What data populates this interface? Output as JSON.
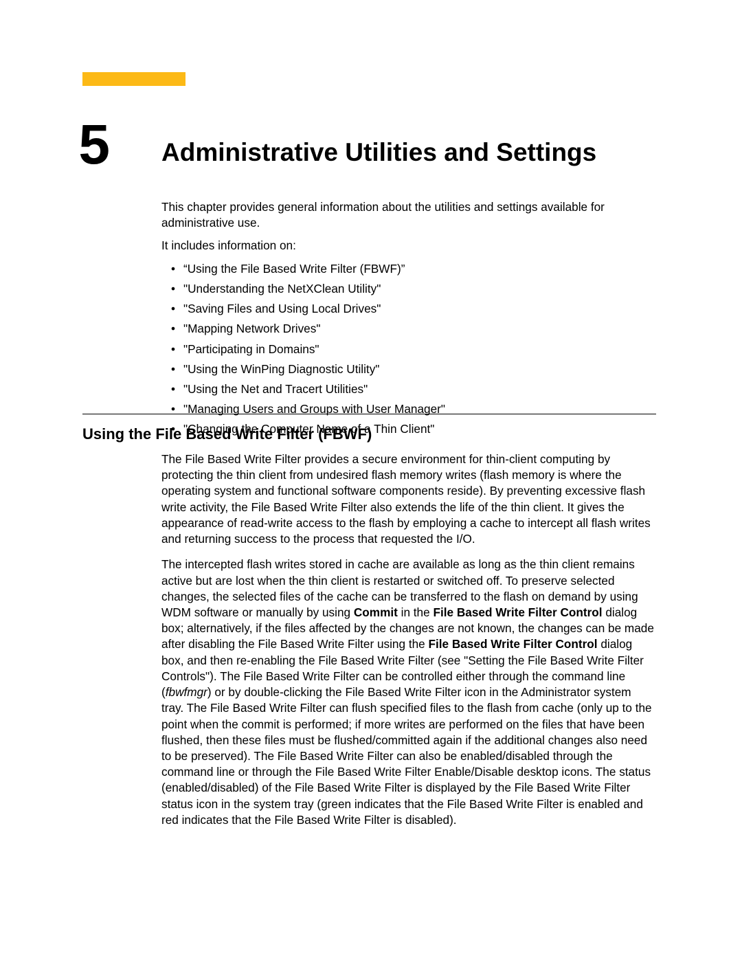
{
  "chapter": {
    "number": "5",
    "title": "Administrative Utilities and Settings"
  },
  "intro": {
    "p1": "This chapter provides general information about the utilities and settings available for administrative use.",
    "p2": "It includes information on:",
    "items": [
      "“Using the File Based Write Filter (FBWF)”",
      "\"Understanding the NetXClean Utility\"",
      "\"Saving Files and Using Local Drives\"",
      "\"Mapping Network Drives\"",
      "\"Participating in Domains\"",
      "\"Using the WinPing Diagnostic Utility\"",
      "\"Using the Net and Tracert Utilities\"",
      "\"Managing Users and Groups with User Manager\"",
      "\"Changing the Computer Name of a Thin Client\""
    ]
  },
  "section": {
    "heading": "Using the File Based Write Filter (FBWF)",
    "p1": "The File Based Write Filter provides a secure environment for thin-client computing by protecting the thin client from undesired flash memory writes (flash memory is where the operating system and functional software components reside). By preventing excessive flash write activity, the File Based Write Filter also extends the life of the thin client. It gives the appearance of read-write access to the flash by employing a cache to intercept all flash writes and returning success to the process that requested the I/O.",
    "p2a": "The intercepted flash writes stored in cache are available as long as the thin client remains active but are lost when the thin client is restarted or switched off. To preserve selected changes, the selected files of the cache can be transferred to the flash on demand by using WDM software or manually by using ",
    "p2b_bold": "Commit",
    "p2c": " in the ",
    "p2d_bold": "File Based Write Filter Control",
    "p2e": " dialog box; alternatively, if the files affected by the changes are not known, the changes can be made after disabling the File Based Write Filter using the ",
    "p2f_bold": "File Based Write Filter Control",
    "p2g": " dialog box, and then re-enabling the File Based Write Filter (see \"Setting the File Based Write Filter Controls\"). The File Based Write Filter can be controlled either through the command line (",
    "p2h_italic": "fbwfmgr",
    "p2i": ") or by double-clicking the File Based Write Filter icon in the Administrator system tray. The File Based Write Filter can flush specified files to the flash from cache (only up to the point when the commit is performed; if more writes are performed on the files that have been flushed, then these files must be flushed/committed again if the additional changes also need to be preserved). The File Based Write Filter can also be enabled/disabled through the command line or through the File Based Write Filter Enable/Disable desktop icons. The status (enabled/disabled) of the File Based Write Filter is displayed by the File Based Write Filter status icon in the system tray (green indicates that the File Based Write Filter is enabled and red indicates that the File Based Write Filter is disabled)."
  }
}
